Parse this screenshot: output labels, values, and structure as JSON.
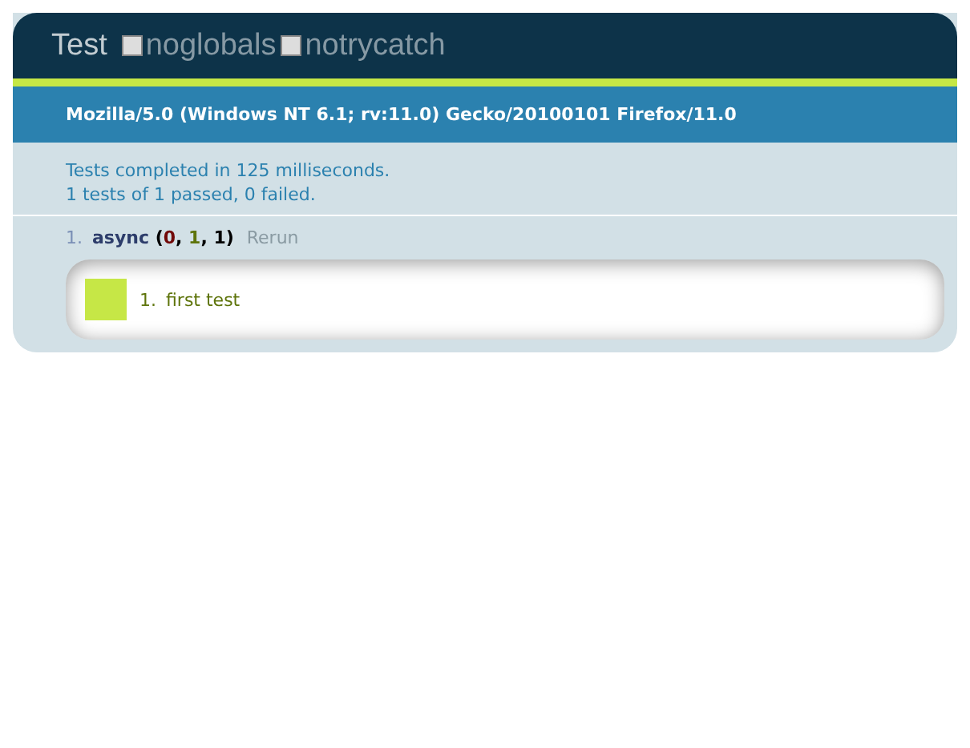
{
  "header": {
    "title": "Test",
    "options": [
      {
        "label": "noglobals",
        "checked": false
      },
      {
        "label": "notrycatch",
        "checked": false
      }
    ]
  },
  "user_agent": "Mozilla/5.0 (Windows NT 6.1; rv:11.0) Gecko/20100101 Firefox/11.0",
  "summary": [
    "Tests completed in 125 milliseconds.",
    "1 tests of 1 passed, 0 failed."
  ],
  "tests": [
    {
      "number": "1.",
      "name": "async",
      "counts": [
        {
          "text": "(",
          "kind": "punct"
        },
        {
          "text": "0",
          "kind": "failed"
        },
        {
          "text": ", ",
          "kind": "punct"
        },
        {
          "text": "1",
          "kind": "passed"
        },
        {
          "text": ", ",
          "kind": "punct"
        },
        {
          "text": "1",
          "kind": "total"
        },
        {
          "text": ")",
          "kind": "punct"
        }
      ],
      "rerun": "Rerun",
      "assertions": [
        {
          "number": "1.",
          "text": "first test",
          "color": "#c6e746"
        }
      ]
    }
  ]
}
